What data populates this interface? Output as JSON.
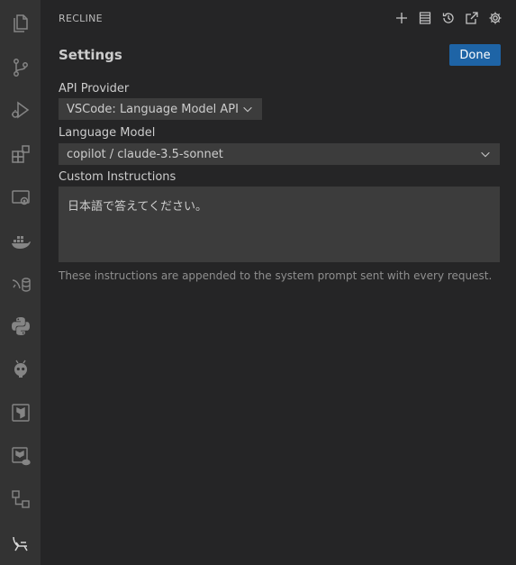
{
  "panel": {
    "title": "RECLINE"
  },
  "header_actions": [
    {
      "icon": "plus-icon"
    },
    {
      "icon": "server-icon"
    },
    {
      "icon": "history-icon"
    },
    {
      "icon": "popout-icon"
    },
    {
      "icon": "gear-icon"
    }
  ],
  "activity_bar": {
    "items": [
      {
        "icon": "files-icon"
      },
      {
        "icon": "source-control-icon"
      },
      {
        "icon": "run-debug-icon"
      },
      {
        "icon": "extensions-icon"
      },
      {
        "icon": "remote-explorer-icon"
      },
      {
        "icon": "docker-icon"
      },
      {
        "icon": "mysql-icon"
      },
      {
        "icon": "python-icon"
      },
      {
        "icon": "platformio-icon"
      },
      {
        "icon": "terraform-icon"
      },
      {
        "icon": "terraform-cloud-icon"
      },
      {
        "icon": "workflow-icon"
      },
      {
        "icon": "recline-icon"
      }
    ]
  },
  "settings": {
    "title": "Settings",
    "done_label": "Done",
    "api_provider_label": "API Provider",
    "api_provider_value": "VSCode: Language Model API",
    "language_model_label": "Language Model",
    "language_model_value": "copilot / claude-3.5-sonnet",
    "custom_instructions_label": "Custom Instructions",
    "custom_instructions_value": "日本語で答えてください。",
    "help_text": "These instructions are appended to the system prompt sent with every request."
  },
  "colors": {
    "background": "#252526",
    "activity_bar": "#333333",
    "input_background": "#3c3c3c",
    "button_primary": "#1e64a6"
  }
}
